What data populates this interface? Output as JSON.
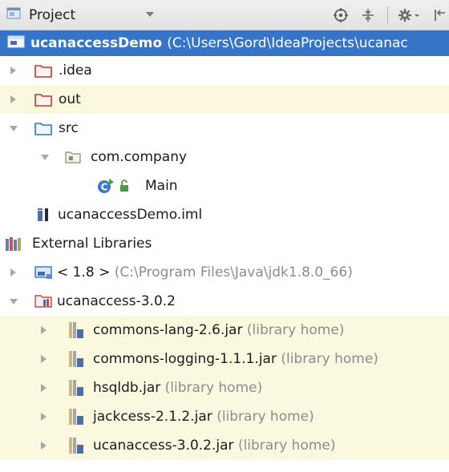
{
  "toolbar": {
    "view_selector": "Project",
    "icons": [
      "locate-icon",
      "collapse-all-icon",
      "settings-icon",
      "hide-panel-icon"
    ]
  },
  "root": {
    "name": "ucanaccessDemo",
    "path": "(C:\\Users\\Gord\\IdeaProjects\\ucanac"
  },
  "tree": [
    {
      "label": ".idea",
      "type": "folder-red"
    },
    {
      "label": "out",
      "type": "folder-red"
    },
    {
      "label": "src",
      "type": "folder-blue"
    },
    {
      "label": "com.company",
      "type": "package"
    },
    {
      "label": "Main",
      "type": "class"
    },
    {
      "label": "ucanaccessDemo.iml",
      "type": "iml"
    },
    {
      "label": "External Libraries",
      "type": "libraries"
    },
    {
      "label": "< 1.8 >",
      "suffix": "(C:\\Program Files\\Java\\jdk1.8.0_66)",
      "type": "jdk"
    },
    {
      "label": "ucanaccess-3.0.2",
      "type": "library"
    },
    {
      "label": "commons-lang-2.6.jar",
      "suffix": "(library home)",
      "type": "jar"
    },
    {
      "label": "commons-logging-1.1.1.jar",
      "suffix": "(library home)",
      "type": "jar"
    },
    {
      "label": "hsqldb.jar",
      "suffix": "(library home)",
      "type": "jar"
    },
    {
      "label": "jackcess-2.1.2.jar",
      "suffix": "(library home)",
      "type": "jar"
    },
    {
      "label": "ucanaccess-3.0.2.jar",
      "suffix": "(library home)",
      "type": "jar"
    }
  ],
  "colors": {
    "selection": "#3574c6",
    "library_tint": "#fbf8e0",
    "folder_excluded": "#c0392b",
    "folder_source": "#3574c6"
  }
}
